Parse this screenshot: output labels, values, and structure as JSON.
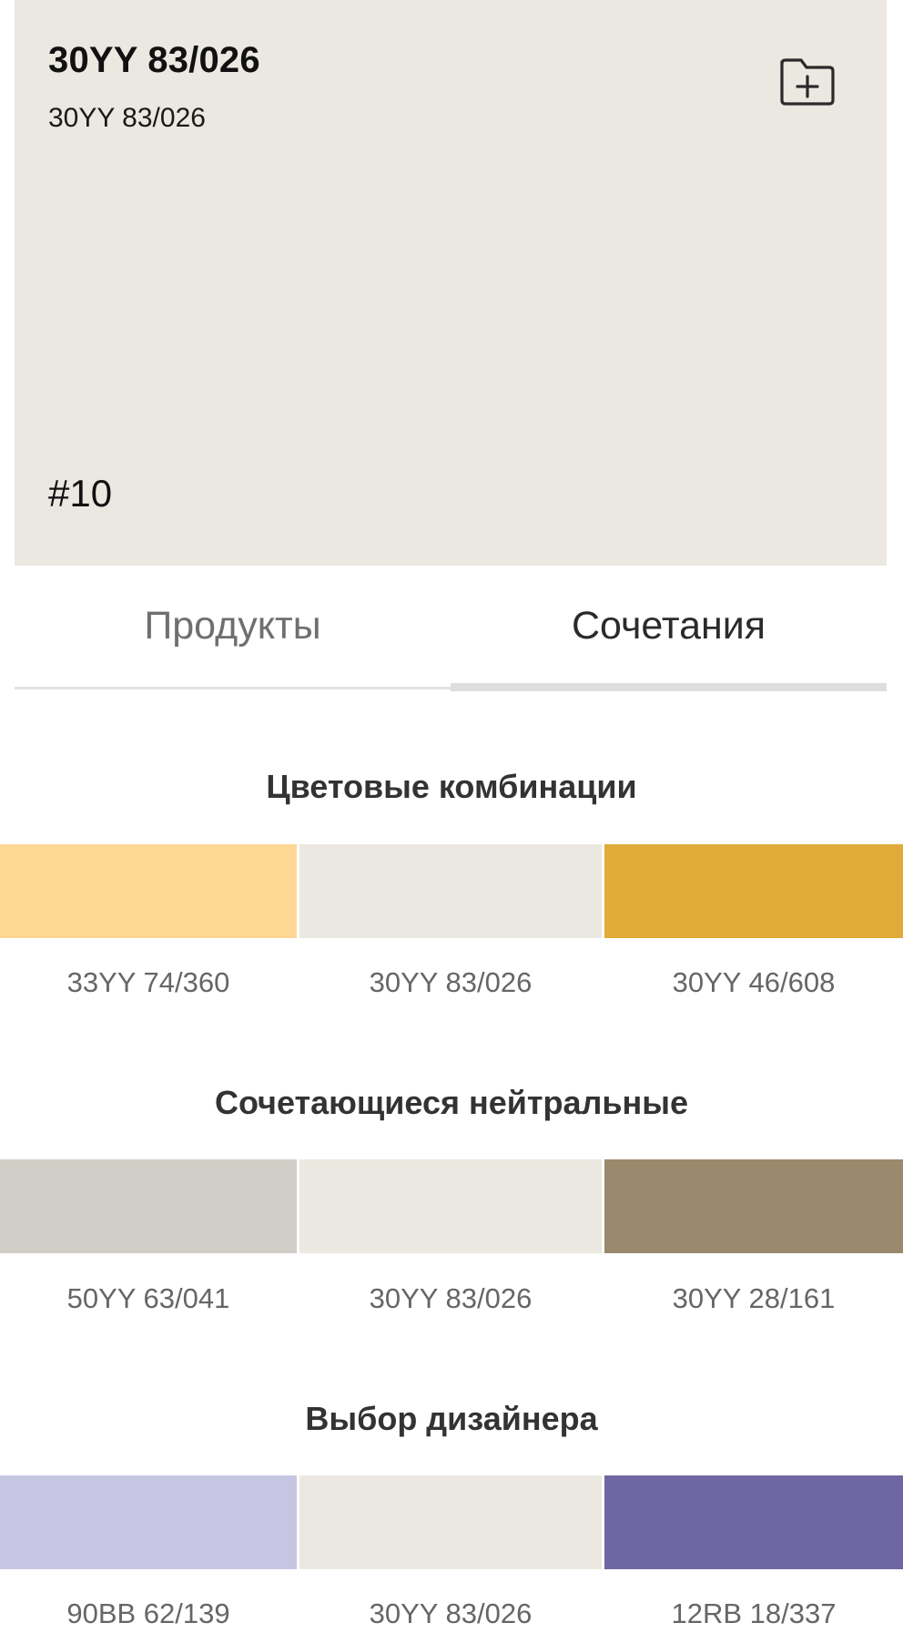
{
  "header": {
    "title": "30YY 83/026",
    "subtitle": "30YY 83/026",
    "number": "#10",
    "background": "#ebe8e1",
    "save_icon": "folder-plus-icon"
  },
  "tabs": [
    {
      "label": "Продукты",
      "active": false
    },
    {
      "label": "Сочетания",
      "active": true
    }
  ],
  "sections": [
    {
      "title": "Цветовые комбинации",
      "swatches": [
        {
          "code": "33YY 74/360",
          "color": "#fed795"
        },
        {
          "code": "30YY 83/026",
          "color": "#ebe8e1"
        },
        {
          "code": "30YY 46/608",
          "color": "#e0ab38"
        }
      ]
    },
    {
      "title": "Сочетающиеся нейтральные",
      "swatches": [
        {
          "code": "50YY 63/041",
          "color": "#d0cec6"
        },
        {
          "code": "30YY 83/026",
          "color": "#ebe8e1"
        },
        {
          "code": "30YY 28/161",
          "color": "#9a896c"
        }
      ]
    },
    {
      "title": "Выбор дизайнера",
      "swatches": [
        {
          "code": "90BB 62/139",
          "color": "#c6c6e2"
        },
        {
          "code": "30YY 83/026",
          "color": "#ebe8e1"
        },
        {
          "code": "12RB 18/337",
          "color": "#6f67a3"
        }
      ]
    }
  ]
}
